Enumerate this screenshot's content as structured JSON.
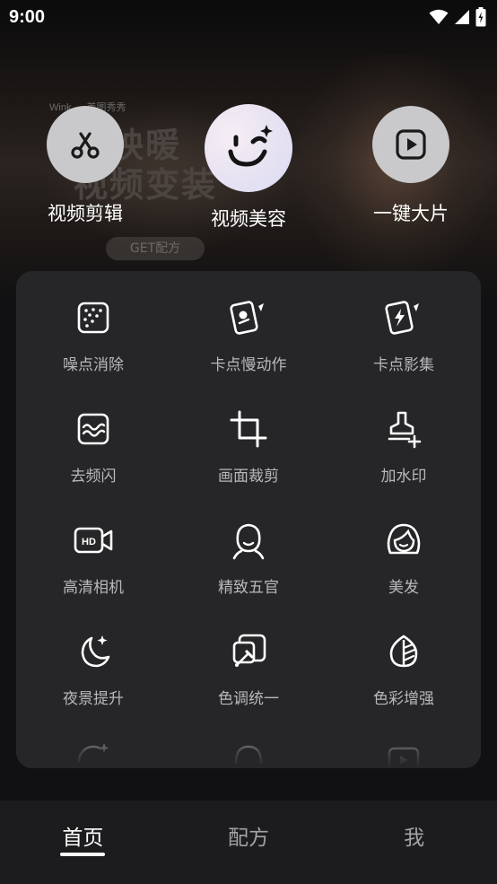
{
  "status_bar": {
    "time": "9:00"
  },
  "banner": {
    "brands": [
      "Wink",
      "美图秀秀"
    ],
    "headline_line1": "影映暖",
    "headline_line2": "视频变装",
    "cta": "GET配方"
  },
  "quick_actions": [
    {
      "label": "视频剪辑",
      "icon": "scissors-icon"
    },
    {
      "label": "视频美容",
      "icon": "wink-face-icon"
    },
    {
      "label": "一键大片",
      "icon": "play-icon"
    }
  ],
  "tools": [
    {
      "label": "噪点消除",
      "icon": "noise-dots-icon"
    },
    {
      "label": "卡点慢动作",
      "icon": "card-slowmo-icon"
    },
    {
      "label": "卡点影集",
      "icon": "card-flash-icon"
    },
    {
      "label": "去频闪",
      "icon": "deflicker-icon"
    },
    {
      "label": "画面裁剪",
      "icon": "crop-icon"
    },
    {
      "label": "加水印",
      "icon": "stamp-icon"
    },
    {
      "label": "高清相机",
      "icon": "hd-camera-icon"
    },
    {
      "label": "精致五官",
      "icon": "face-features-icon"
    },
    {
      "label": "美发",
      "icon": "hair-icon"
    },
    {
      "label": "夜景提升",
      "icon": "moon-star-icon"
    },
    {
      "label": "色调统一",
      "icon": "color-picker-icon"
    },
    {
      "label": "色彩增强",
      "icon": "leaf-icon"
    }
  ],
  "bottom_nav": [
    {
      "label": "首页",
      "active": true
    },
    {
      "label": "配方",
      "active": false
    },
    {
      "label": "我",
      "active": false
    }
  ],
  "colors": {
    "panel": "#262628",
    "nav": "#1c1c1e",
    "tool_label": "#b8b8ba"
  }
}
